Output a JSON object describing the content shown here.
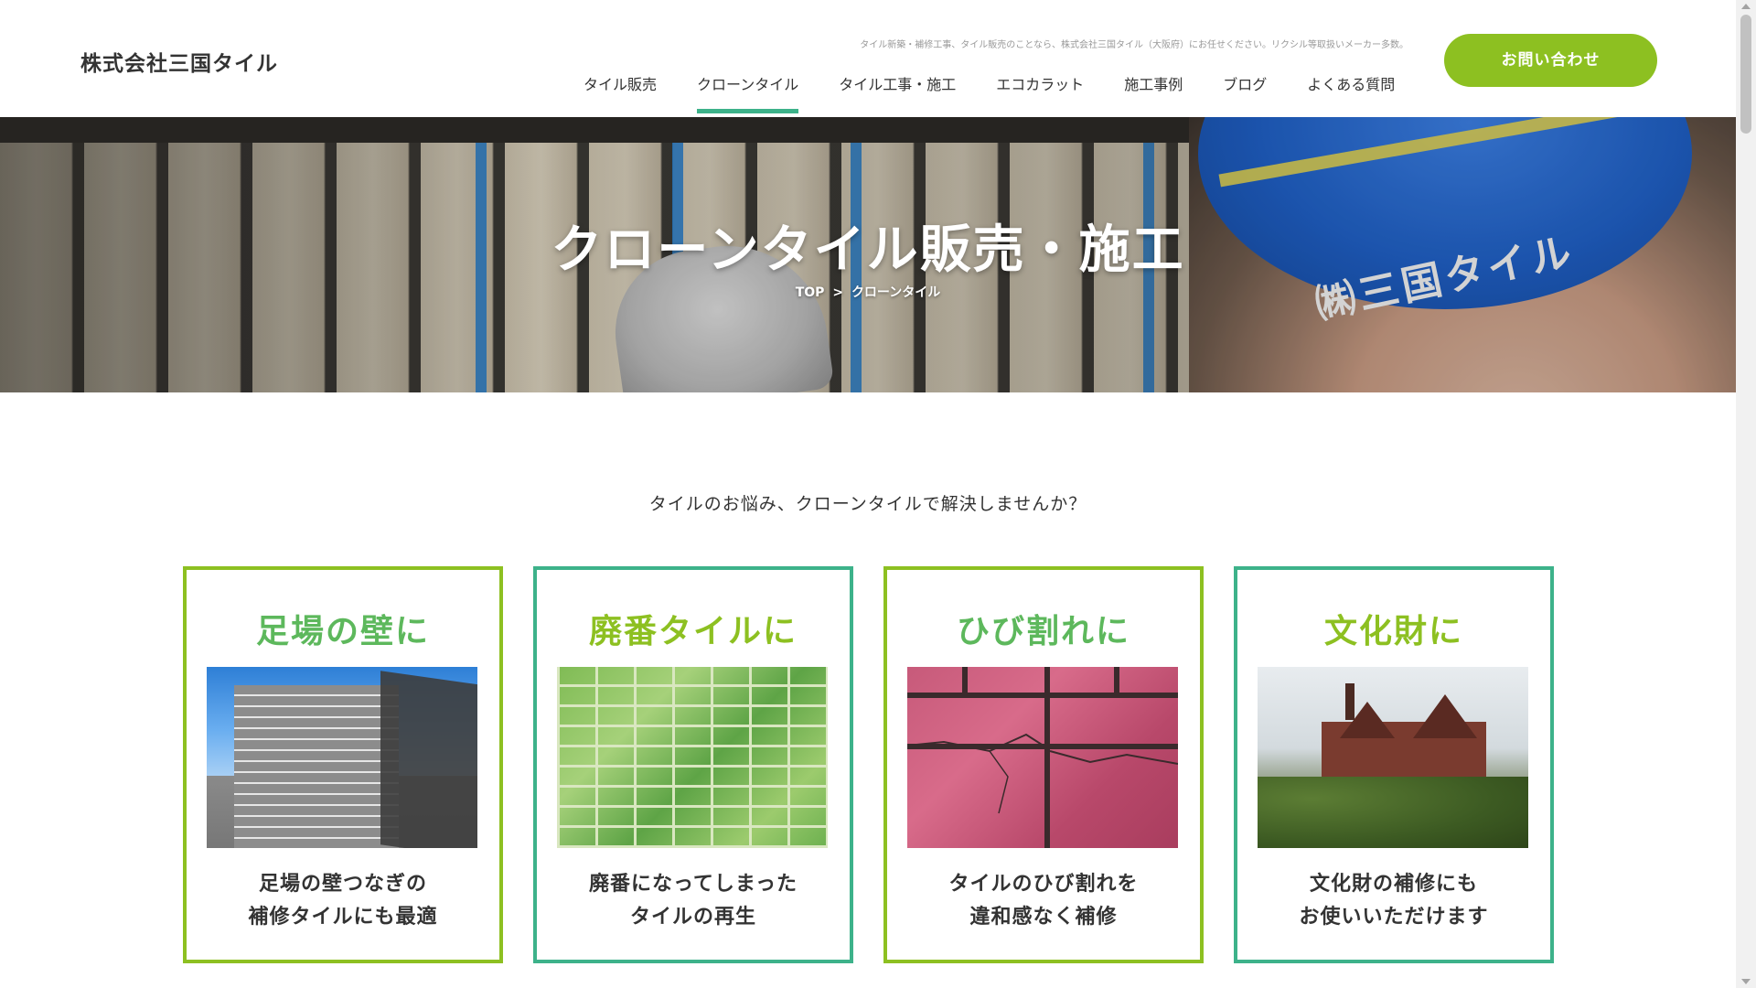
{
  "header": {
    "logo": "株式会社三国タイル",
    "tagline": "タイル新築・補修工事、タイル販売のことなら、株式会社三国タイル（大阪府）にお任せください。リクシル等取扱いメーカー多数。",
    "nav": [
      {
        "label": "タイル販売"
      },
      {
        "label": "クローンタイル"
      },
      {
        "label": "タイル工事・施工"
      },
      {
        "label": "エコカラット"
      },
      {
        "label": "施工事例"
      },
      {
        "label": "ブログ"
      },
      {
        "label": "よくある質問"
      }
    ],
    "active_nav": "クローンタイル",
    "contact_label": "お問い合わせ"
  },
  "hero": {
    "title": "クローンタイル販売・施工",
    "helmet_text": "㈱三国タイル",
    "breadcrumb": {
      "home": "TOP",
      "separator": ">",
      "current": "クローンタイル"
    }
  },
  "lead": "タイルのお悩み、クローンタイルで解決しませんか？",
  "cards": [
    {
      "title": "足場の壁に",
      "line1": "足場の壁つなぎの",
      "line2": "補修タイルにも最適"
    },
    {
      "title": "廃番タイルに",
      "line1": "廃番になってしまった",
      "line2": "タイルの再生"
    },
    {
      "title": "ひび割れに",
      "line1": "タイルのひび割れを",
      "line2": "違和感なく補修"
    },
    {
      "title": "文化財に",
      "line1": "文化財の補修にも",
      "line2": "お使いいただけます"
    }
  ],
  "colors": {
    "accent_green": "#8dc021",
    "accent_teal": "#3db28a",
    "card_title_green": "#5db85c"
  }
}
